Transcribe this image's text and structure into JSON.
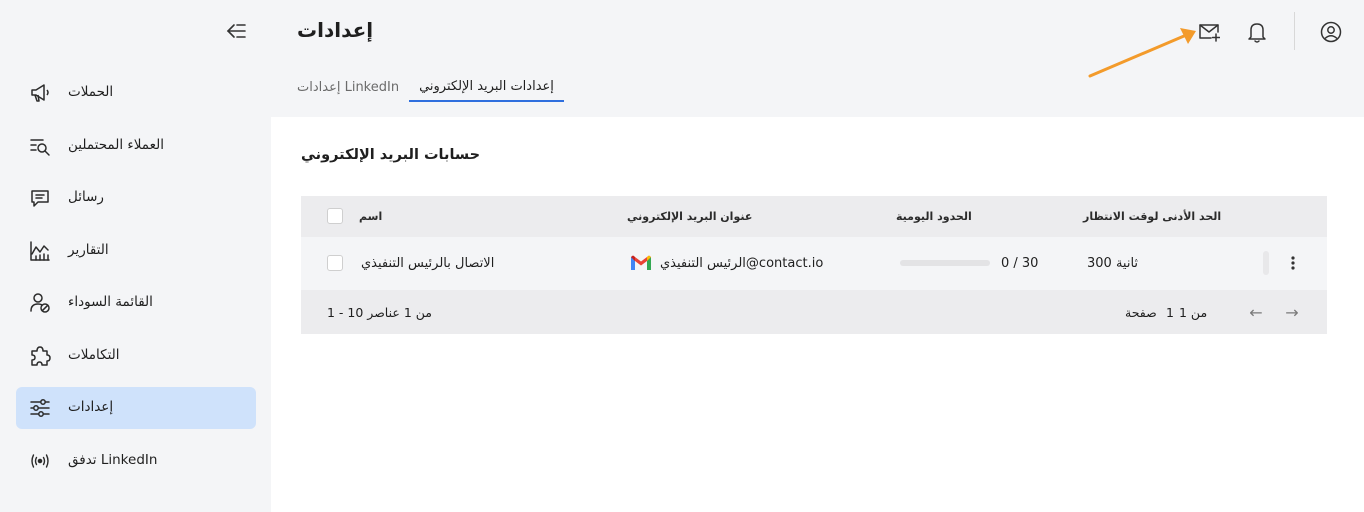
{
  "sidebar": {
    "collapse_icon": "collapse-sidebar-icon",
    "items": [
      {
        "label": "الحملات",
        "icon": "megaphone-icon",
        "active": false
      },
      {
        "label": "العملاء المحتملين",
        "icon": "prospects-search-icon",
        "active": false
      },
      {
        "label": "رسائل",
        "icon": "message-icon",
        "active": false
      },
      {
        "label": "التقارير",
        "icon": "chart-icon",
        "active": false
      },
      {
        "label": "القائمة السوداء",
        "icon": "user-block-icon",
        "active": false
      },
      {
        "label": "التكاملات",
        "icon": "puzzle-icon",
        "active": false
      },
      {
        "label": "إعدادات",
        "icon": "sliders-icon",
        "active": true
      },
      {
        "label": "تدفق LinkedIn",
        "icon": "broadcast-icon",
        "active": false
      }
    ]
  },
  "header": {
    "title": "إعدادات",
    "tabs": [
      {
        "label": "إعدادات LinkedIn",
        "active": false
      },
      {
        "label": "إعدادات البريد الإلكتروني",
        "active": true
      }
    ],
    "icons": [
      "add-mail-icon",
      "bell-icon",
      "user-profile-icon"
    ]
  },
  "content": {
    "section_title": "حسابات البريد الإلكتروني",
    "table": {
      "columns": {
        "name": "اسم",
        "email": "عنوان البريد الإلكتروني",
        "daily_limits": "الحدود اليومية",
        "min_wait": "الحد الأدنى لوقت الانتظار"
      },
      "rows": [
        {
          "name": "الاتصال بالرئيس التنفيذي",
          "email": "الرئيس التنفيذي@contact.io",
          "daily_limit": "0 / 30",
          "daily_used_fraction": 0,
          "min_wait": "ثانية 300"
        }
      ],
      "footer": {
        "range": "1 - 10 من 1 عناصر",
        "page_word": "صفحة",
        "page_current": "1",
        "page_of": "من 1"
      }
    }
  },
  "colors": {
    "accent": "#2f6fde",
    "sidebar_active": "#cfe2fb",
    "annotation_arrow": "#f39b2b"
  }
}
